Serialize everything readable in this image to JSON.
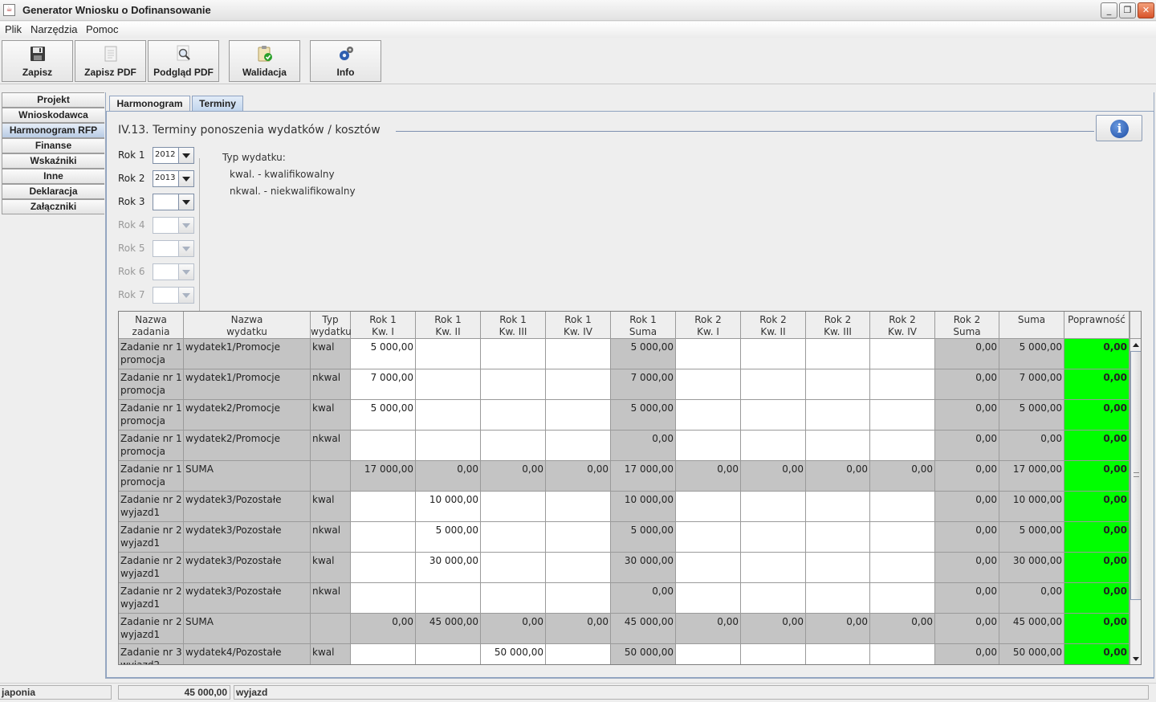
{
  "window": {
    "title": "Generator Wniosku o Dofinansowanie",
    "minimize": "_",
    "restore": "❐",
    "close": "✕"
  },
  "menu": [
    "Plik",
    "Narzędzia",
    "Pomoc"
  ],
  "toolbar": [
    {
      "label": "Zapisz",
      "icon": "floppy-disk-icon"
    },
    {
      "label": "Zapisz PDF",
      "icon": "pdf-document-icon"
    },
    {
      "label": "Podgląd PDF",
      "icon": "magnifier-icon"
    },
    {
      "label": "Walidacja",
      "icon": "clipboard-check-icon"
    },
    {
      "label": "Info",
      "icon": "gears-icon"
    }
  ],
  "sidebar": {
    "items": [
      "Projekt",
      "Wnioskodawca",
      "Harmonogram RFP",
      "Finanse",
      "Wskaźniki",
      "Inne",
      "Deklaracja",
      "Załączniki"
    ],
    "active": "Harmonogram RFP"
  },
  "tabs": [
    {
      "label": "Harmonogram",
      "selected": false
    },
    {
      "label": "Terminy",
      "selected": true
    }
  ],
  "section": {
    "title": "IV.13. Terminy ponoszenia wydatków / kosztów",
    "info_icon": "i"
  },
  "years": [
    {
      "label": "Rok 1",
      "value": "2012",
      "enabled": true
    },
    {
      "label": "Rok 2",
      "value": "2013",
      "enabled": true
    },
    {
      "label": "Rok 3",
      "value": "",
      "enabled": true
    },
    {
      "label": "Rok 4",
      "value": "",
      "enabled": false
    },
    {
      "label": "Rok 5",
      "value": "",
      "enabled": false
    },
    {
      "label": "Rok 6",
      "value": "",
      "enabled": false
    },
    {
      "label": "Rok 7",
      "value": "",
      "enabled": false
    }
  ],
  "legend": {
    "title": "Typ wydatku:",
    "kwal": "kwal.   - kwalifikowalny",
    "nkwal": "nkwal. - niekwalifikowalny"
  },
  "table": {
    "columns": [
      "Nazwa\nzadania",
      "Nazwa\nwydatku",
      "Typ\nwydatku",
      "Rok 1\nKw. I",
      "Rok 1\nKw. II",
      "Rok 1\nKw. III",
      "Rok 1\nKw. IV",
      "Rok 1\nSuma",
      "Rok 2\nKw. I",
      "Rok 2\nKw. II",
      "Rok 2\nKw. III",
      "Rok 2\nKw. IV",
      "Rok 2\nSuma",
      "Suma",
      "Poprawność"
    ],
    "rows": [
      {
        "task": "Zadanie  nr  1\npromocja",
        "expense": "wydatek1/Promocje",
        "type": "kwal",
        "q": [
          "5 000,00",
          "",
          "",
          "",
          "5 000,00",
          "",
          "",
          "",
          "",
          "0,00",
          "5 000,00",
          "0,00"
        ],
        "sum_row": false
      },
      {
        "task": "Zadanie  nr  1\npromocja",
        "expense": "wydatek1/Promocje",
        "type": "nkwal",
        "q": [
          "7 000,00",
          "",
          "",
          "",
          "7 000,00",
          "",
          "",
          "",
          "",
          "0,00",
          "7 000,00",
          "0,00"
        ],
        "sum_row": false
      },
      {
        "task": "Zadanie  nr  1\npromocja",
        "expense": "wydatek2/Promocje",
        "type": "kwal",
        "q": [
          "5 000,00",
          "",
          "",
          "",
          "5 000,00",
          "",
          "",
          "",
          "",
          "0,00",
          "5 000,00",
          "0,00"
        ],
        "sum_row": false
      },
      {
        "task": "Zadanie  nr  1\npromocja",
        "expense": "wydatek2/Promocje",
        "type": "nkwal",
        "q": [
          "",
          "",
          "",
          "",
          "0,00",
          "",
          "",
          "",
          "",
          "0,00",
          "0,00",
          "0,00"
        ],
        "sum_row": false
      },
      {
        "task": "Zadanie  nr  1\npromocja",
        "expense": "SUMA",
        "type": "",
        "q": [
          "17 000,00",
          "0,00",
          "0,00",
          "0,00",
          "17 000,00",
          "0,00",
          "0,00",
          "0,00",
          "0,00",
          "0,00",
          "17 000,00",
          "0,00"
        ],
        "sum_row": true
      },
      {
        "task": "Zadanie  nr  2\nwyjazd1",
        "expense": "wydatek3/Pozostałe",
        "type": "kwal",
        "q": [
          "",
          "10 000,00",
          "",
          "",
          "10 000,00",
          "",
          "",
          "",
          "",
          "0,00",
          "10 000,00",
          "0,00"
        ],
        "sum_row": false
      },
      {
        "task": "Zadanie  nr  2\nwyjazd1",
        "expense": "wydatek3/Pozostałe",
        "type": "nkwal",
        "q": [
          "",
          "5 000,00",
          "",
          "",
          "5 000,00",
          "",
          "",
          "",
          "",
          "0,00",
          "5 000,00",
          "0,00"
        ],
        "sum_row": false
      },
      {
        "task": "Zadanie  nr  2\nwyjazd1",
        "expense": "wydatek3/Pozostałe",
        "type": "kwal",
        "q": [
          "",
          "30 000,00",
          "",
          "",
          "30 000,00",
          "",
          "",
          "",
          "",
          "0,00",
          "30 000,00",
          "0,00"
        ],
        "sum_row": false
      },
      {
        "task": "Zadanie  nr  2\nwyjazd1",
        "expense": "wydatek3/Pozostałe",
        "type": "nkwal",
        "q": [
          "",
          "",
          "",
          "",
          "0,00",
          "",
          "",
          "",
          "",
          "0,00",
          "0,00",
          "0,00"
        ],
        "sum_row": false
      },
      {
        "task": "Zadanie  nr  2\nwyjazd1",
        "expense": "SUMA",
        "type": "",
        "q": [
          "0,00",
          "45 000,00",
          "0,00",
          "0,00",
          "45 000,00",
          "0,00",
          "0,00",
          "0,00",
          "0,00",
          "0,00",
          "45 000,00",
          "0,00"
        ],
        "sum_row": true
      },
      {
        "task": "Zadanie  nr  3\nwyjazd2",
        "expense": "wydatek4/Pozostałe",
        "type": "kwal",
        "q": [
          "",
          "",
          "50 000,00",
          "",
          "50 000,00",
          "",
          "",
          "",
          "",
          "0,00",
          "50 000,00",
          "0,00"
        ],
        "sum_row": false
      }
    ]
  },
  "statusbar": {
    "name": "japonia",
    "amount": "45 000,00",
    "category": "wyjazd"
  },
  "colors": {
    "valid": "#00ff00",
    "computed_cell": "#c4c4c4",
    "active_nav": "#b8cbe4"
  }
}
